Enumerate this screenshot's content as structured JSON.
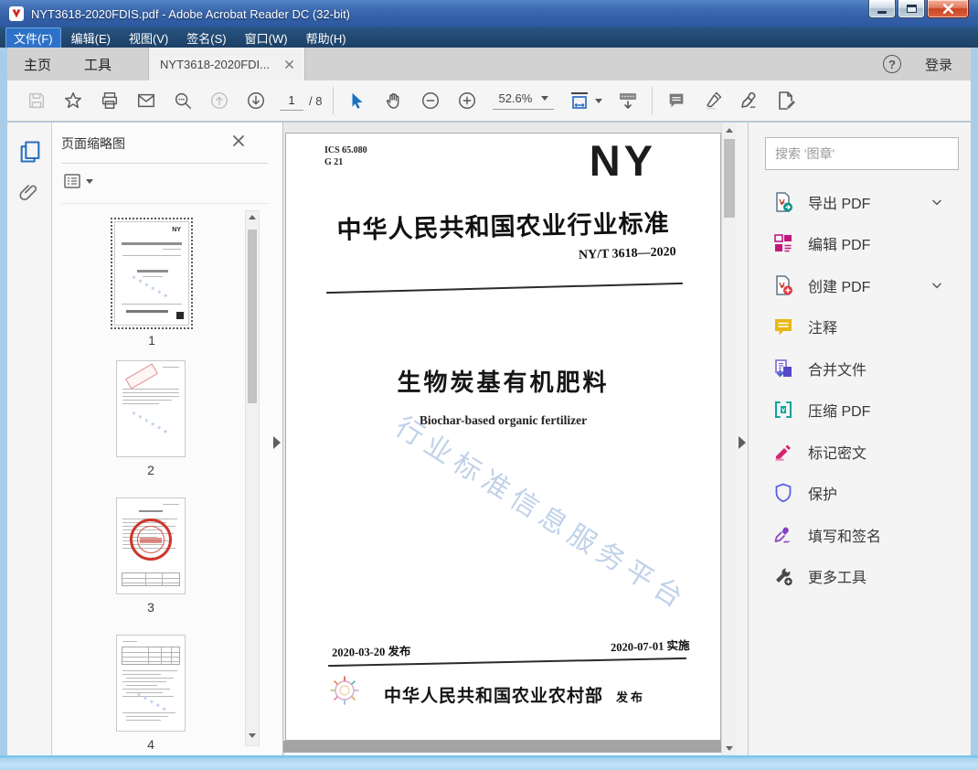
{
  "window": {
    "title": "NYT3618-2020FDIS.pdf - Adobe Acrobat Reader DC (32-bit)"
  },
  "menu": {
    "items": [
      {
        "label": "文件(F)",
        "active": true
      },
      {
        "label": "编辑(E)"
      },
      {
        "label": "视图(V)"
      },
      {
        "label": "签名(S)"
      },
      {
        "label": "窗口(W)"
      },
      {
        "label": "帮助(H)"
      }
    ]
  },
  "tabbar": {
    "home": "主页",
    "tools": "工具",
    "document": "NYT3618-2020FDI...",
    "help_glyph": "?",
    "signin": "登录"
  },
  "toolbar": {
    "page_current": "1",
    "page_total": "/ 8",
    "zoom_level": "52.6%"
  },
  "left_panel": {
    "title": "页面缩略图",
    "thumbnails": [
      {
        "number": "1"
      },
      {
        "number": "2"
      },
      {
        "number": "3"
      },
      {
        "number": "4"
      }
    ]
  },
  "document": {
    "ics": "ICS 65.080",
    "class_code": "G 21",
    "logo": "NY",
    "standard_title": "中华人民共和国农业行业标准",
    "standard_number": "NY/T 3618—2020",
    "title_cn": "生物炭基有机肥料",
    "title_en": "Biochar-based organic fertilizer",
    "watermark": "行业标准信息服务平台",
    "issue_date": "2020-03-20 发布",
    "implement_date": "2020-07-01 实施",
    "publisher": "中华人民共和国农业农村部",
    "publish_label": "发布"
  },
  "right_panel": {
    "search_placeholder": "搜索 '图章'",
    "tools": [
      {
        "label": "导出 PDF",
        "chevron": true
      },
      {
        "label": "编辑 PDF"
      },
      {
        "label": "创建 PDF",
        "chevron": true
      },
      {
        "label": "注释"
      },
      {
        "label": "合并文件"
      },
      {
        "label": "压缩 PDF"
      },
      {
        "label": "标记密文"
      },
      {
        "label": "保护"
      },
      {
        "label": "填写和签名"
      },
      {
        "label": "更多工具"
      }
    ]
  },
  "colors": {
    "accent_blue": "#1a72c4",
    "titlebar_blue": "#3a67ae",
    "seal_red": "#cd372b",
    "watermark_blue": "#b6cbe6"
  }
}
